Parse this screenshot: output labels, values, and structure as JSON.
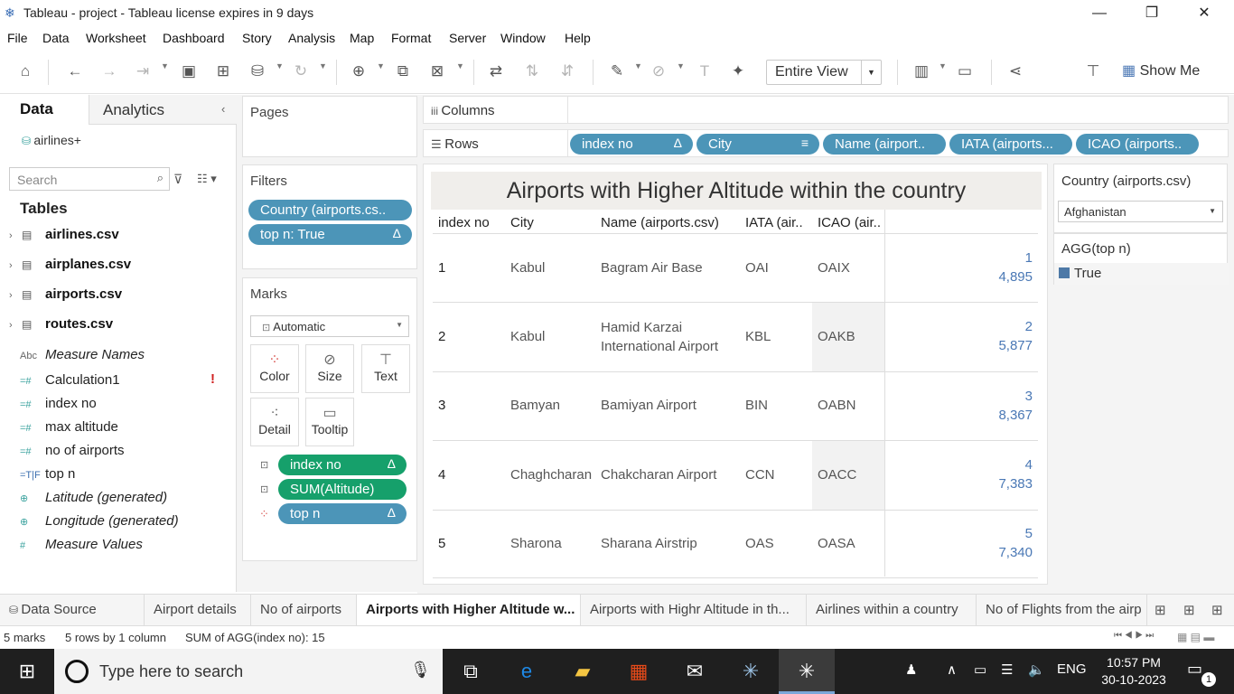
{
  "window": {
    "title": "Tableau - project - Tableau license expires in 9 days",
    "app_icon": "tableau-snowflake-icon"
  },
  "menu": [
    "File",
    "Data",
    "Worksheet",
    "Dashboard",
    "Story",
    "Analysis",
    "Map",
    "Format",
    "Server",
    "Window",
    "Help"
  ],
  "toolbar": {
    "view_select": "Entire View",
    "show_me": "Show Me"
  },
  "data_pane": {
    "tab_data": "Data",
    "tab_analytics": "Analytics",
    "datasource": "airlines+",
    "search_placeholder": "Search",
    "tables_heading": "Tables",
    "tables": [
      "airlines.csv",
      "airplanes.csv",
      "airports.csv",
      "routes.csv"
    ],
    "fields": [
      {
        "icon": "Abc",
        "name": "Measure Names",
        "italic": true
      },
      {
        "icon": "=#",
        "name": "Calculation1",
        "italic": false
      },
      {
        "icon": "=#",
        "name": "index no",
        "italic": false
      },
      {
        "icon": "=#",
        "name": "max altitude",
        "italic": false
      },
      {
        "icon": "=#",
        "name": "no of airports",
        "italic": false
      },
      {
        "icon": "=T|F",
        "name": "top n",
        "italic": false
      },
      {
        "icon": "⊕",
        "name": "Latitude (generated)",
        "italic": true
      },
      {
        "icon": "⊕",
        "name": "Longitude (generated)",
        "italic": true
      },
      {
        "icon": "#",
        "name": "Measure Values",
        "italic": true
      }
    ],
    "error_mark": "!"
  },
  "pages_label": "Pages",
  "filters": {
    "label": "Filters",
    "pills": [
      "Country (airports.cs..",
      "top n: True"
    ]
  },
  "marks": {
    "label": "Marks",
    "type": "Automatic",
    "buttons": [
      "Color",
      "Size",
      "Text",
      "Detail",
      "Tooltip"
    ],
    "pills": [
      "index no",
      "SUM(Altitude)",
      "top n"
    ],
    "delta": "Δ"
  },
  "shelves": {
    "columns_label": "Columns",
    "rows_label": "Rows",
    "rows_pills": [
      "index no",
      "City",
      "Name (airport..",
      "IATA (airports...",
      "ICAO (airports.."
    ]
  },
  "viz": {
    "title": "Airports with Higher Altitude within the country",
    "headers": [
      "index no",
      "City",
      "Name (airports.csv)",
      "IATA (air..",
      "ICAO (air.."
    ],
    "rows": [
      {
        "index": "1",
        "city": "Kabul",
        "name": "Bagram Air Base",
        "iata": "OAI",
        "icao": "OAIX",
        "rank": "1",
        "altitude": "4,895"
      },
      {
        "index": "2",
        "city": "Kabul",
        "name": "Hamid Karzai International Airport",
        "iata": "KBL",
        "icao": "OAKB",
        "rank": "2",
        "altitude": "5,877"
      },
      {
        "index": "3",
        "city": "Bamyan",
        "name": "Bamiyan Airport",
        "iata": "BIN",
        "icao": "OABN",
        "rank": "3",
        "altitude": "8,367"
      },
      {
        "index": "4",
        "city": "Chaghcharan",
        "name": "Chakcharan Airport",
        "iata": "CCN",
        "icao": "OACC",
        "rank": "4",
        "altitude": "7,383"
      },
      {
        "index": "5",
        "city": "Sharona",
        "name": "Sharana Airstrip",
        "iata": "OAS",
        "icao": "OASA",
        "rank": "5",
        "altitude": "7,340"
      }
    ]
  },
  "right_pane": {
    "country_filter_title": "Country (airports.csv)",
    "country_value": "Afghanistan",
    "legend_title": "AGG(top n)",
    "legend_item": "True",
    "legend_color": "#4e79a7"
  },
  "sheet_tabs": [
    "Data Source",
    "Airport details",
    "No of airports",
    "Airports with Higher Altitude w...",
    "Airports with Highr Altitude in th...",
    "Airlines within a country",
    "No of Flights from the airp"
  ],
  "status": {
    "marks": "5 marks",
    "rows": "5 rows by 1 column",
    "sum": "SUM of AGG(index no): 15"
  },
  "taskbar": {
    "search_placeholder": "Type here to search",
    "lang": "ENG",
    "time": "10:57 PM",
    "date": "30-10-2023",
    "notif_count": "1"
  }
}
